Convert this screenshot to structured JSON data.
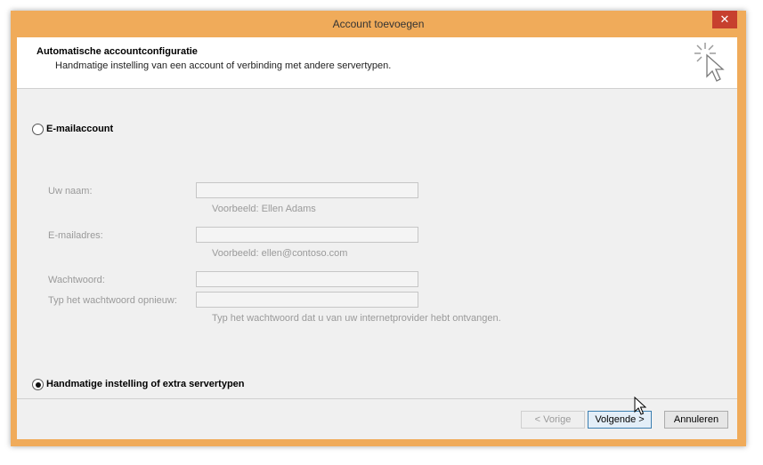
{
  "window": {
    "title": "Account toevoegen",
    "close_glyph": "✕"
  },
  "header": {
    "title": "Automatische accountconfiguratie",
    "subtitle": "Handmatige instelling van een account of verbinding met andere servertypen.",
    "icon": "cursor-sparkle-icon"
  },
  "options": {
    "email_account": {
      "label": "E-mailaccount",
      "checked": false
    },
    "manual": {
      "label": "Handmatige instelling of extra servertypen",
      "checked": true
    }
  },
  "form": {
    "name_label": "Uw naam:",
    "name_value": "",
    "name_hint": "Voorbeeld: Ellen Adams",
    "email_label": "E-mailadres:",
    "email_value": "",
    "email_hint": "Voorbeeld: ellen@contoso.com",
    "password_label": "Wachtwoord:",
    "password_value": "",
    "password_repeat_label": "Typ het wachtwoord opnieuw:",
    "password_repeat_value": "",
    "password_hint": "Typ het wachtwoord dat u van uw internetprovider hebt ontvangen."
  },
  "buttons": {
    "back": "< Vorige",
    "next": "Volgende >",
    "cancel": "Annuleren"
  }
}
